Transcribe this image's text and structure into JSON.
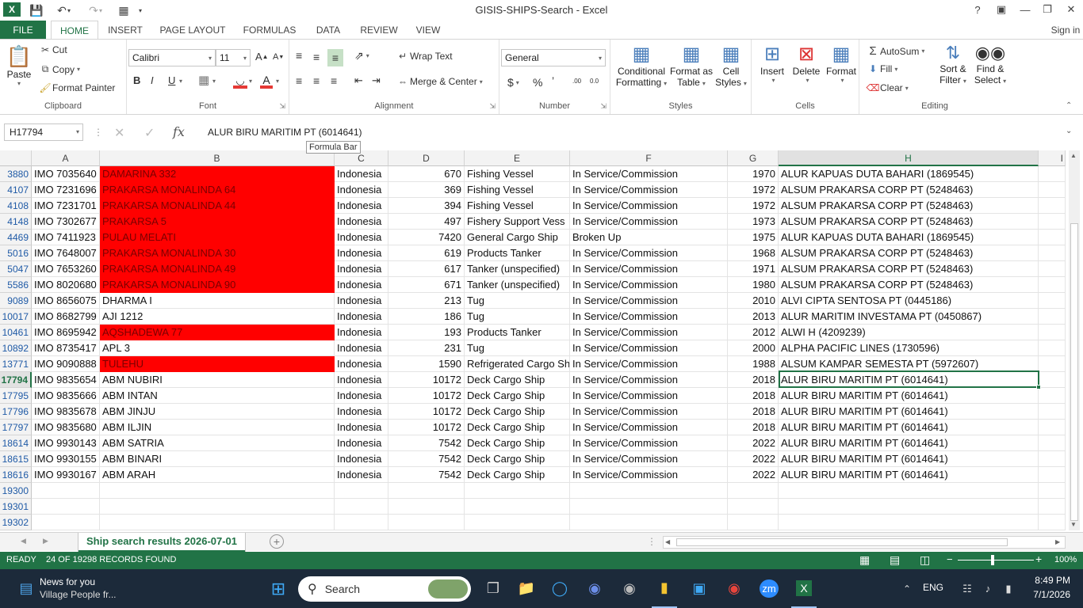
{
  "window": {
    "title": "GISIS-SHIPS-Search - Excel",
    "signin": "Sign in"
  },
  "tabs": [
    "FILE",
    "HOME",
    "INSERT",
    "PAGE LAYOUT",
    "FORMULAS",
    "DATA",
    "REVIEW",
    "VIEW"
  ],
  "ribbon": {
    "clipboard": {
      "label": "Clipboard",
      "paste": "Paste",
      "cut": "Cut",
      "copy": "Copy",
      "format_painter": "Format Painter"
    },
    "font": {
      "label": "Font",
      "name": "Calibri",
      "size": "11",
      "bold": "B",
      "italic": "I",
      "underline": "U"
    },
    "alignment": {
      "label": "Alignment",
      "wrap": "Wrap Text",
      "merge": "Merge & Center"
    },
    "number": {
      "label": "Number",
      "format": "General",
      "currency": "$",
      "percent": "%",
      "comma": "’",
      "inc_dec": ".00",
      "dec_dec": "0.0"
    },
    "styles": {
      "label": "Styles",
      "conditional": "Conditional",
      "conditional2": "Formatting",
      "format_table": "Format as",
      "format_table2": "Table",
      "cell_styles": "Cell",
      "cell_styles2": "Styles"
    },
    "cells": {
      "label": "Cells",
      "insert": "Insert",
      "delete": "Delete",
      "format": "Format"
    },
    "editing": {
      "label": "Editing",
      "autosum": "AutoSum",
      "fill": "Fill",
      "clear": "Clear",
      "sort": "Sort &",
      "sort2": "Filter",
      "find": "Find &",
      "find2": "Select"
    }
  },
  "formula_bar": {
    "name_box": "H17794",
    "fx": "fx",
    "value": "ALUR BIRU MARITIM PT (6014641)",
    "tooltip": "Formula Bar"
  },
  "columns": [
    "A",
    "B",
    "C",
    "D",
    "E",
    "F",
    "G",
    "H",
    "I"
  ],
  "rows": [
    {
      "num": "3880",
      "a": "IMO 7035640",
      "b": "DAMARINA 332",
      "c": "Indonesia",
      "d": "670",
      "e": "Fishing Vessel",
      "f": "In Service/Commission",
      "g": "1970",
      "h": "ALUR KAPUAS DUTA BAHARI (1869545)",
      "red": true
    },
    {
      "num": "4107",
      "a": "IMO 7231696",
      "b": "PRAKARSA MONALINDA 64",
      "c": "Indonesia",
      "d": "369",
      "e": "Fishing Vessel",
      "f": "In Service/Commission",
      "g": "1972",
      "h": "ALSUM PRAKARSA CORP PT (5248463)",
      "red": true
    },
    {
      "num": "4108",
      "a": "IMO 7231701",
      "b": "PRAKARSA MONALINDA 44",
      "c": "Indonesia",
      "d": "394",
      "e": "Fishing Vessel",
      "f": "In Service/Commission",
      "g": "1972",
      "h": "ALSUM PRAKARSA CORP PT (5248463)",
      "red": true
    },
    {
      "num": "4148",
      "a": "IMO 7302677",
      "b": "PRAKARSA 5",
      "c": "Indonesia",
      "d": "497",
      "e": "Fishery Support Vess",
      "f": "In Service/Commission",
      "g": "1973",
      "h": "ALSUM PRAKARSA CORP PT (5248463)",
      "red": true
    },
    {
      "num": "4469",
      "a": "IMO 7411923",
      "b": "PULAU MELATI",
      "c": "Indonesia",
      "d": "7420",
      "e": "General Cargo Ship",
      "f": "Broken Up",
      "g": "1975",
      "h": "ALUR KAPUAS DUTA BAHARI (1869545)",
      "red": true
    },
    {
      "num": "5016",
      "a": "IMO 7648007",
      "b": "PRAKARSA MONALINDA 30",
      "c": "Indonesia",
      "d": "619",
      "e": "Products Tanker",
      "f": "In Service/Commission",
      "g": "1968",
      "h": "ALSUM PRAKARSA CORP PT (5248463)",
      "red": true
    },
    {
      "num": "5047",
      "a": "IMO 7653260",
      "b": "PRAKARSA MONALINDA 49",
      "c": "Indonesia",
      "d": "617",
      "e": "Tanker (unspecified)",
      "f": "In Service/Commission",
      "g": "1971",
      "h": "ALSUM PRAKARSA CORP PT (5248463)",
      "red": true
    },
    {
      "num": "5586",
      "a": "IMO 8020680",
      "b": "PRAKARSA MONALINDA 90",
      "c": "Indonesia",
      "d": "671",
      "e": "Tanker (unspecified)",
      "f": "In Service/Commission",
      "g": "1980",
      "h": "ALSUM PRAKARSA CORP PT (5248463)",
      "red": true
    },
    {
      "num": "9089",
      "a": "IMO 8656075",
      "b": "DHARMA I",
      "c": "Indonesia",
      "d": "213",
      "e": "Tug",
      "f": "In Service/Commission",
      "g": "2010",
      "h": "ALVI CIPTA SENTOSA PT (0445186)",
      "red": false
    },
    {
      "num": "10017",
      "a": "IMO 8682799",
      "b": "AJI 1212",
      "c": "Indonesia",
      "d": "186",
      "e": "Tug",
      "f": "In Service/Commission",
      "g": "2013",
      "h": "ALUR MARITIM INVESTAMA PT (0450867)",
      "red": false
    },
    {
      "num": "10461",
      "a": "IMO 8695942",
      "b": "AQSHADEWA 77",
      "c": "Indonesia",
      "d": "193",
      "e": "Products Tanker",
      "f": "In Service/Commission",
      "g": "2012",
      "h": "ALWI H (4209239)",
      "red": true
    },
    {
      "num": "10892",
      "a": "IMO 8735417",
      "b": "APL 3",
      "c": "Indonesia",
      "d": "231",
      "e": "Tug",
      "f": "In Service/Commission",
      "g": "2000",
      "h": "ALPHA PACIFIC LINES (1730596)",
      "red": false
    },
    {
      "num": "13771",
      "a": "IMO 9090888",
      "b": "TULEHU",
      "c": "Indonesia",
      "d": "1590",
      "e": "Refrigerated Cargo Sh",
      "f": "In Service/Commission",
      "g": "1988",
      "h": "ALSUM KAMPAR SEMESTA PT (5972607)",
      "red": true
    },
    {
      "num": "17794",
      "a": "IMO 9835654",
      "b": "ABM NUBIRI",
      "c": "Indonesia",
      "d": "10172",
      "e": "Deck Cargo Ship",
      "f": "In Service/Commission",
      "g": "2018",
      "h": "ALUR BIRU MARITIM PT (6014641)",
      "red": false
    },
    {
      "num": "17795",
      "a": "IMO 9835666",
      "b": "ABM INTAN",
      "c": "Indonesia",
      "d": "10172",
      "e": "Deck Cargo Ship",
      "f": "In Service/Commission",
      "g": "2018",
      "h": "ALUR BIRU MARITIM PT (6014641)",
      "red": false
    },
    {
      "num": "17796",
      "a": "IMO 9835678",
      "b": "ABM JINJU",
      "c": "Indonesia",
      "d": "10172",
      "e": "Deck Cargo Ship",
      "f": "In Service/Commission",
      "g": "2018",
      "h": "ALUR BIRU MARITIM PT (6014641)",
      "red": false
    },
    {
      "num": "17797",
      "a": "IMO 9835680",
      "b": "ABM ILJIN",
      "c": "Indonesia",
      "d": "10172",
      "e": "Deck Cargo Ship",
      "f": "In Service/Commission",
      "g": "2018",
      "h": "ALUR BIRU MARITIM PT (6014641)",
      "red": false
    },
    {
      "num": "18614",
      "a": "IMO 9930143",
      "b": "ABM SATRIA",
      "c": "Indonesia",
      "d": "7542",
      "e": "Deck Cargo Ship",
      "f": "In Service/Commission",
      "g": "2022",
      "h": "ALUR BIRU MARITIM PT (6014641)",
      "red": false
    },
    {
      "num": "18615",
      "a": "IMO 9930155",
      "b": "ABM BINARI",
      "c": "Indonesia",
      "d": "7542",
      "e": "Deck Cargo Ship",
      "f": "In Service/Commission",
      "g": "2022",
      "h": "ALUR BIRU MARITIM PT (6014641)",
      "red": false
    },
    {
      "num": "18616",
      "a": "IMO 9930167",
      "b": "ABM ARAH",
      "c": "Indonesia",
      "d": "7542",
      "e": "Deck Cargo Ship",
      "f": "In Service/Commission",
      "g": "2022",
      "h": "ALUR BIRU MARITIM PT (6014641)",
      "red": false
    },
    {
      "num": "19300",
      "a": "",
      "b": "",
      "c": "",
      "d": "",
      "e": "",
      "f": "",
      "g": "",
      "h": "",
      "red": false
    },
    {
      "num": "19301",
      "a": "",
      "b": "",
      "c": "",
      "d": "",
      "e": "",
      "f": "",
      "g": "",
      "h": "",
      "red": false
    },
    {
      "num": "19302",
      "a": "",
      "b": "",
      "c": "",
      "d": "",
      "e": "",
      "f": "",
      "g": "",
      "h": "",
      "red": false
    }
  ],
  "selected_row": "17794",
  "sheet_tab": "Ship search results 2026-07-01",
  "status": {
    "ready": "READY",
    "records": "24 OF 19298 RECORDS FOUND",
    "zoom": "100%"
  },
  "taskbar": {
    "news_title": "News for you",
    "news_sub": "Village People fr...",
    "search": "Search",
    "lang": "ENG",
    "time": "8:49 PM",
    "date": "7/1/2026"
  },
  "colors": {
    "accent": "#217346",
    "highlight_red": "#ff0000"
  }
}
